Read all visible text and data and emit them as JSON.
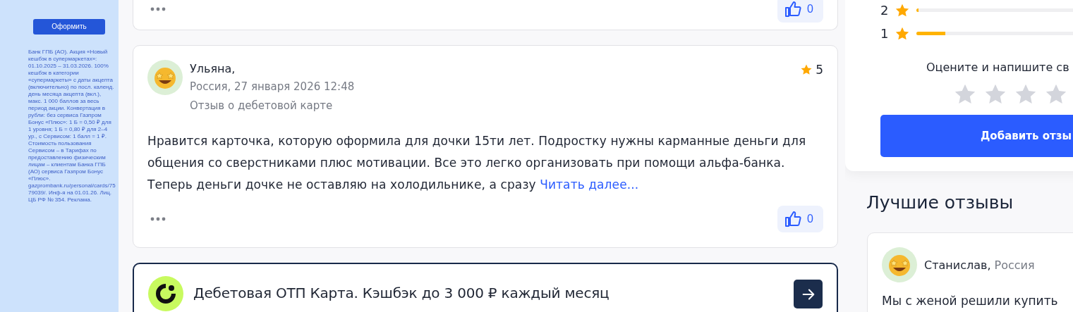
{
  "sidebar_ad": {
    "button": "Оформить",
    "disclaimer": "Банк ГПБ (АО). Акция «Новый кешбэк в супермаркетах»: 01.10.2025 – 31.03.2026. 100% кешбэк в категории «супермаркеты» с даты акцепта (включительно) по посл. календ. день месяца акцепта (вкл.), макс. 1 000 баллов за весь период акции. Конвертация в рубли: без сервиса Газпром Бонус «Плюс»: 1 Б = 0,50 ₽ для 1 уровня; 1 Б = 0,80 ₽ для 2–4 ур., с Сервисом: 1 балл = 1 ₽. Стоимость пользования Сервисом – в Тарифах по предоставлению физическим лицам – клиентам Банка ГПБ (АО) сервиса Газпром Бонус «Плюс». gazprombank.ru/personal/cards/7579039/. Инф-я на 01.01.26. Лиц. ЦБ РФ № 354. Реклама."
  },
  "reviews": [
    {
      "kind": "partial",
      "likes": "0"
    },
    {
      "kind": "full",
      "author": "Ульяна,",
      "meta": "Россия, 27 января 2026 12:48",
      "subject": "Отзыв о дебетовой карте",
      "rating": "5",
      "text": "Нравится карточка, которую оформила для дочки 15ти лет. Подростку нужны карманные деньги для общения со сверстниками плюс мотивации. Все это легко организовать при помощи альфа-банка. Теперь деньги дочке не оставляю на холодильнике, а сразу",
      "read_more": "Читать далее...",
      "likes": "0"
    }
  ],
  "promo": {
    "title": "Дебетовая ОТП Карта. Кэшбэк до 3 000 ₽ каждый месяц"
  },
  "rating_summary": {
    "rows": [
      {
        "label": "2",
        "level": 0.01
      },
      {
        "label": "1",
        "level": 0.13
      }
    ],
    "prompt": "Оцените и напишите св",
    "stars": 0,
    "button": "Добавить отзы"
  },
  "best_reviews": {
    "title": "Лучшие отзывы",
    "items": [
      {
        "author": "Станислав,",
        "location": "Россия",
        "text": "Мы с женой решили купить"
      }
    ]
  }
}
